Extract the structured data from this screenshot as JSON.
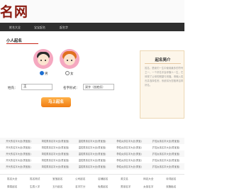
{
  "site": {
    "logo": "名网"
  },
  "nav": {
    "items": [
      "姓名大全",
      "宝宝起名",
      "起名字"
    ]
  },
  "section": {
    "title": "小人起名"
  },
  "gender": {
    "male": "男",
    "female": "女",
    "selected": "male"
  },
  "form": {
    "surname_label": "姓氏：",
    "surname_value": "王",
    "format_label": "名字形式：",
    "format_value": "双字（含姓氏）",
    "submit_label": "马上起名"
  },
  "intro": {
    "title": "起名简介",
    "text": "姓名，是我们一生中使用最多的符号之一，一个好名字会伴随人一生，它体现了父母的期望与祝福。请输入姓氏并选择性别，系统将为您推荐吉祥好名。"
  },
  "table": {
    "rows": [
      [
        "开头的名字大全(男宝宝)",
        "简姓男孩名字大全(男宝宝)",
        "温姓男孩名字大全(男宝宝)",
        "李姓女孩名字大全(男宝)",
        "扩姓女孩名字大全(男宝宝)"
      ],
      [
        "开头的名字大全(男宝宝)",
        "简姓男孩名字大全(男宝宝)",
        "温姓男孩名字大全(男宝宝)",
        "李姓女孩名字大全(男宝)",
        "扩姓女孩名字大全(男宝宝)"
      ],
      [
        "开头的名字大全(男宝宝)",
        "简姓男孩名字大全(男宝宝)",
        "温姓男孩名字大全(男宝宝)",
        "李姓女孩名字大全(男宝)",
        "扩姓女孩名字大全(男宝宝)"
      ],
      [
        "开头的名字大全(男宝宝)",
        "简姓男孩名字大全(男宝宝)",
        "温姓男孩名字大全(男宝宝)",
        "李姓女孩名字大全(男宝)",
        "扩姓女孩名字大全(男宝宝)"
      ],
      [
        "开头的名字大全(男宝宝)",
        "简姓男孩名字大全(男宝宝)",
        "温姓男孩名字大全(男宝宝)",
        "李姓女孩名字大全(男宝)",
        "扩姓女孩名字大全(男宝宝)"
      ]
    ]
  },
  "footer": {
    "row1": [
      "姓名大全",
      "姓名测试",
      "宝宝起名",
      "公司起名",
      "店铺起名",
      "英文名",
      "网名大全",
      "诗词起名"
    ],
    "row2": [
      "周易起名",
      "生辰八字",
      "五行起名",
      "名字打分",
      "免费起名",
      "男孩名字",
      "女孩名字",
      "双胞胎名"
    ]
  },
  "colors": {
    "accent": "#c8261a",
    "nav_bg": "#2f2f2f",
    "button": "#f07c12",
    "avatar_bg": "#f5a8c0"
  },
  "icons": {
    "boy_avatar": "boy-avatar-icon",
    "girl_avatar": "girl-avatar-icon"
  }
}
